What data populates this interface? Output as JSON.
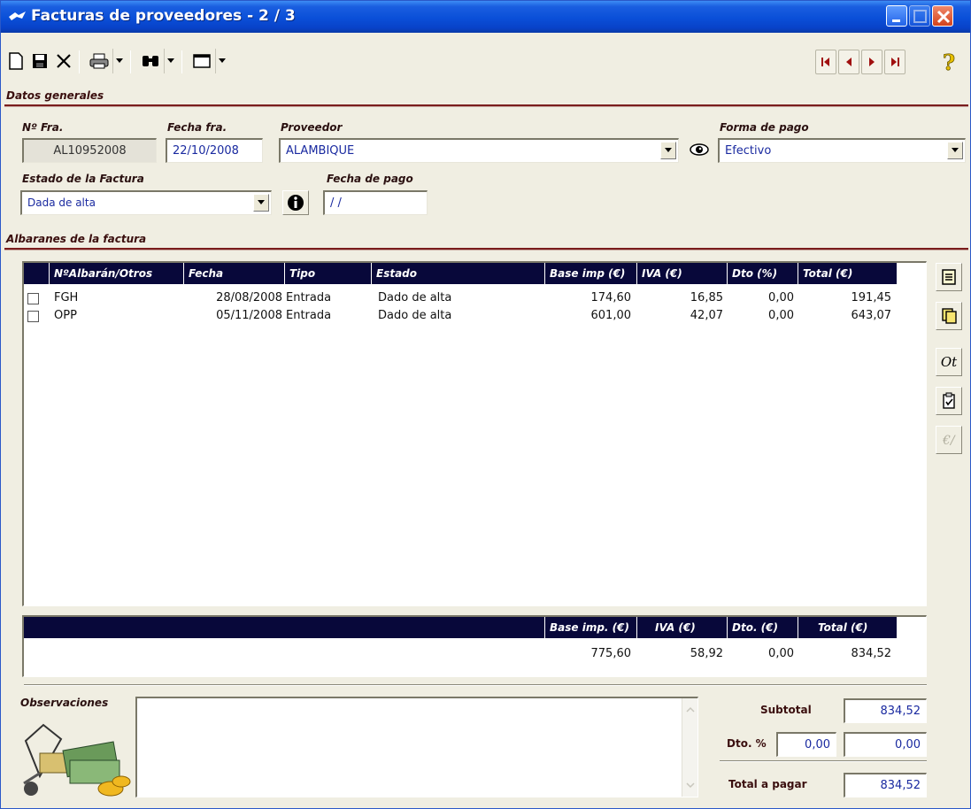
{
  "window": {
    "title": "Facturas de proveedores - 2 / 3"
  },
  "sections": {
    "general": "Datos generales",
    "albaranes": "Albaranes de la factura"
  },
  "fields": {
    "num_fra": {
      "label": "Nº Fra.",
      "value": "AL10952008"
    },
    "fecha_fra": {
      "label": "Fecha fra.",
      "value": "22/10/2008"
    },
    "proveedor": {
      "label": "Proveedor",
      "value": "ALAMBIQUE"
    },
    "forma_pago": {
      "label": "Forma de pago",
      "value": "Efectivo"
    },
    "estado": {
      "label": "Estado de la Factura",
      "value": "Dada de alta"
    },
    "fecha_pago": {
      "label": "Fecha de pago",
      "value": "/ /"
    }
  },
  "albaranes": {
    "columns": [
      "NºAlbarán/Otros",
      "Fecha",
      "Tipo",
      "Estado",
      "Base imp (€)",
      "IVA (€)",
      "Dto (%)",
      "Total (€)"
    ],
    "rows": [
      {
        "num": "FGH",
        "fecha": "28/08/2008",
        "tipo": "Entrada",
        "estado": "Dado de alta",
        "base": "174,60",
        "iva": "16,85",
        "dto": "0,00",
        "total": "191,45",
        "checked": false
      },
      {
        "num": "OPP",
        "fecha": "05/11/2008",
        "tipo": "Entrada",
        "estado": "Dado de alta",
        "base": "601,00",
        "iva": "42,07",
        "dto": "0,00",
        "total": "643,07",
        "checked": false
      }
    ]
  },
  "summary": {
    "columns": [
      "Base imp. (€)",
      "IVA (€)",
      "Dto. (€)",
      "Total (€)"
    ],
    "values": {
      "base": "775,60",
      "iva": "58,92",
      "dto": "0,00",
      "total": "834,52"
    }
  },
  "side_buttons": {
    "ot_label": "Ot"
  },
  "observaciones": {
    "label": "Observaciones",
    "value": ""
  },
  "totals": {
    "subtotal_label": "Subtotal",
    "subtotal": "834,52",
    "dto_label": "Dto. %",
    "dto_pct": "0,00",
    "dto_amount": "0,00",
    "total_label": "Total a pagar",
    "total": "834,52"
  },
  "colors": {
    "titlebar": "#0a4fd8",
    "section_rule": "#7a1d1d",
    "grid_header": "#08083a",
    "field_text": "#1a2aa0"
  }
}
